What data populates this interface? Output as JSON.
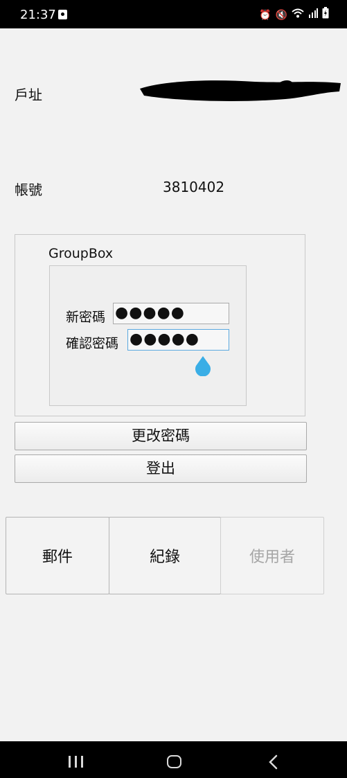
{
  "status_bar": {
    "time": "21:37",
    "icons": [
      "notification-icon",
      "alarm-icon",
      "mute-icon",
      "wifi-icon",
      "signal-icon",
      "battery-icon"
    ]
  },
  "account": {
    "address_label": "戶址",
    "account_label": "帳號",
    "account_value": "3810402"
  },
  "groupbox": {
    "title": "GroupBox",
    "new_password_label": "新密碼",
    "new_password_value": "●●●●●",
    "confirm_password_label": "確認密碼",
    "confirm_password_value": "●●●●●"
  },
  "buttons": {
    "change_password": "更改密碼",
    "logout": "登出"
  },
  "tabs": [
    {
      "label": "郵件",
      "enabled": true
    },
    {
      "label": "紀錄",
      "enabled": true
    },
    {
      "label": "使用者",
      "enabled": false
    }
  ],
  "colors": {
    "accent": "#3aaee6",
    "background": "#f2f2f2"
  }
}
